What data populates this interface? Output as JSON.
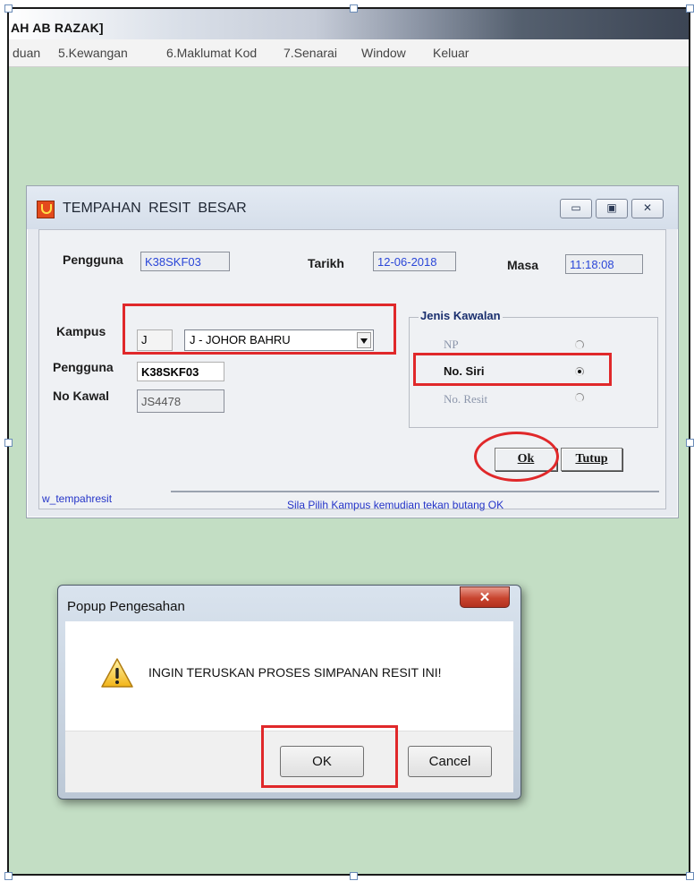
{
  "app": {
    "title": "AH AB RAZAK]",
    "menu": [
      "duan",
      "5.Kewangan",
      "6.Maklumat Kod",
      "7.Senarai",
      "Window",
      "Keluar"
    ]
  },
  "resit_window": {
    "title": "TEMPAHAN  RESIT  BESAR",
    "controls": {
      "minimize": "▭",
      "maximize": "▣",
      "close": "✕"
    },
    "header": {
      "pengguna_label": "Pengguna",
      "pengguna_value": "K38SKF03",
      "tarikh_label": "Tarikh",
      "tarikh_value": "12-06-2018",
      "masa_label": "Masa",
      "masa_value": "11:18:08"
    },
    "form": {
      "kampus_label": "Kampus",
      "kampus_code": "J",
      "kampus_selected": "J - JOHOR BAHRU",
      "pengguna_label": "Pengguna",
      "pengguna_value": "K38SKF03",
      "no_kawal_label": "No Kawal",
      "no_kawal_value": "JS4478"
    },
    "jenis_kawalan": {
      "legend": "Jenis Kawalan",
      "options": [
        {
          "label": "NP",
          "selected": false,
          "enabled": false
        },
        {
          "label": "No. Siri",
          "selected": true,
          "enabled": true
        },
        {
          "label": "No. Resit",
          "selected": false,
          "enabled": false
        }
      ]
    },
    "buttons": {
      "ok": "Ok",
      "tutup": "Tutup"
    },
    "status": {
      "window_name": "w_tempahresit",
      "message": "Sila Pilih Kampus kemudian tekan butang OK"
    }
  },
  "popup": {
    "title": "Popup Pengesahan",
    "close": "✕",
    "message": "INGIN TERUSKAN PROSES SIMPANAN RESIT INI!",
    "ok": "OK",
    "cancel": "Cancel",
    "icon": "warning-icon"
  },
  "colors": {
    "desktop_green": "#c3dec4",
    "highlight_red": "#e0282a",
    "status_blue": "#2434c8"
  }
}
